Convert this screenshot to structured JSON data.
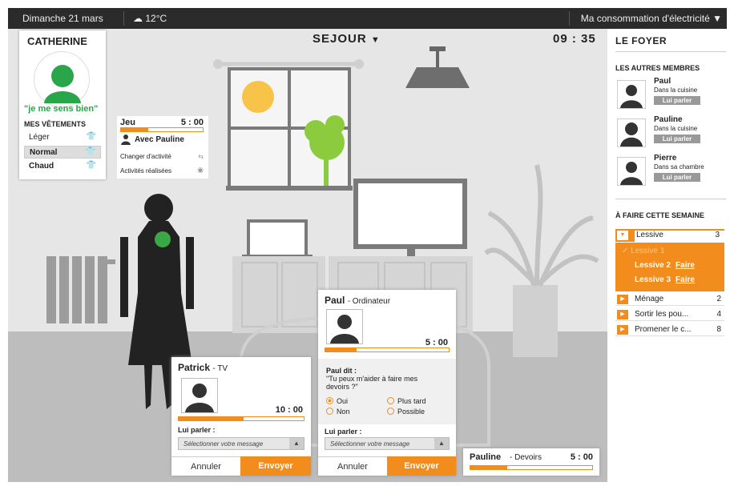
{
  "topbar": {
    "date": "Dimanche 21 mars",
    "weather": "12°C",
    "weather_icon": "cloud-sun-icon",
    "consumption": "Ma consommation d'électricité",
    "consumption_arrow": "▼"
  },
  "room": {
    "title": "SEJOUR",
    "arrow": "▼",
    "time": "09 : 35"
  },
  "profile": {
    "name": "CATHERINE",
    "mood": "\"je me sens bien\"",
    "clothes_title": "MES VÊTEMENTS",
    "clothes": [
      {
        "label": "Léger",
        "selected": false
      },
      {
        "label": "Normal",
        "selected": true
      },
      {
        "label": "Chaud",
        "selected": false
      }
    ]
  },
  "activity": {
    "name": "Jeu",
    "time": "5 : 00",
    "progress": 0.33,
    "with": "Avec Pauline",
    "change": "Changer d'activité",
    "done": "Activités réalisées"
  },
  "patrick_card": {
    "name": "Patrick",
    "device": "- TV",
    "time": "10 : 00",
    "progress": 0.5,
    "talk_label": "Lui parler :",
    "select_placeholder": "Sélectionner votre message",
    "cancel": "Annuler",
    "send": "Envoyer"
  },
  "paul_card": {
    "name": "Paul",
    "device": "- Ordinateur",
    "time": "5 : 00",
    "progress": 0.25,
    "says_label": "Paul dit :",
    "quote": "\"Tu peux m'aider à faire mes devoirs ?\"",
    "options": [
      {
        "label": "Oui",
        "selected": true
      },
      {
        "label": "Plus tard",
        "selected": false
      },
      {
        "label": "Non",
        "selected": false
      },
      {
        "label": "Possible",
        "selected": false
      }
    ],
    "talk_label": "Lui parler :",
    "select_placeholder": "Sélectionner votre message",
    "cancel": "Annuler",
    "send": "Envoyer"
  },
  "pauline_card": {
    "name": "Pauline",
    "device": "- Devoirs",
    "time": "5 : 00",
    "progress": 0.3
  },
  "sidebar": {
    "title": "LE FOYER",
    "members_title": "LES AUTRES MEMBRES",
    "members": [
      {
        "name": "Paul",
        "location": "Dans la cuisine",
        "action": "Lui parler"
      },
      {
        "name": "Pauline",
        "location": "Dans la cuisine",
        "action": "Lui parler"
      },
      {
        "name": "Pierre",
        "location": "Dans sa chambre",
        "action": "Lui parler"
      }
    ],
    "tasks_title": "À FAIRE CETTE SEMAINE",
    "tasks": [
      {
        "label": "Lessive",
        "count": "3",
        "expanded": true,
        "sub": [
          {
            "label": "Lessive 1",
            "done": true,
            "action": ""
          },
          {
            "label": "Lessive 2",
            "done": false,
            "action": "Faire"
          },
          {
            "label": "Lessive 3",
            "done": false,
            "action": "Faire"
          }
        ]
      },
      {
        "label": "Ménage",
        "count": "2",
        "expanded": false
      },
      {
        "label": "Sortir les pou...",
        "count": "4",
        "expanded": false
      },
      {
        "label": "Promener le c...",
        "count": "8",
        "expanded": false
      }
    ]
  },
  "colors": {
    "accent": "#f28c1c",
    "mood": "#2aa64a",
    "topbar": "#2b2b2b"
  }
}
